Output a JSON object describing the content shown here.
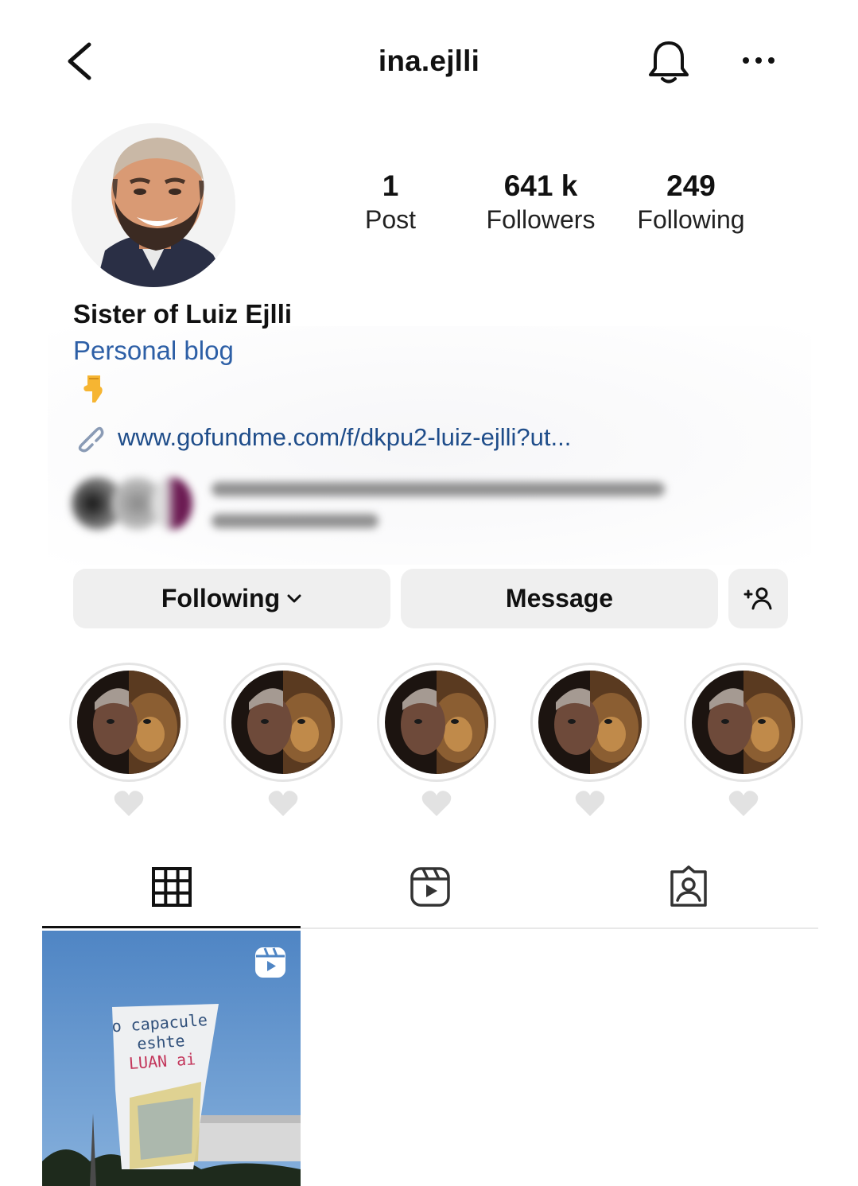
{
  "header": {
    "username": "ina.ejlli",
    "back_icon": "chevron-left-icon",
    "bell_icon": "bell-icon",
    "more_icon": "more-horizontal-icon"
  },
  "profile": {
    "stats": [
      {
        "value": "1",
        "label": "Post"
      },
      {
        "value": "641 k",
        "label": "Followers"
      },
      {
        "value": "249",
        "label": "Following"
      }
    ],
    "display_name": "Sister of Luiz Ejlli",
    "category": "Personal blog",
    "emoji": "👇",
    "link": "www.gofundme.com/f/dkpu2-luiz-ejlli?ut..."
  },
  "actions": {
    "following_label": "Following",
    "message_label": "Message",
    "add_icon": "add-person-icon"
  },
  "highlights": [
    {
      "label_icon": "white-heart-icon"
    },
    {
      "label_icon": "white-heart-icon"
    },
    {
      "label_icon": "white-heart-icon"
    },
    {
      "label_icon": "white-heart-icon"
    },
    {
      "label_icon": "white-heart-icon"
    }
  ],
  "tabs": [
    {
      "icon": "grid-icon",
      "active": true
    },
    {
      "icon": "reels-icon",
      "active": false
    },
    {
      "icon": "tagged-icon",
      "active": false
    }
  ],
  "posts": [
    {
      "type": "reel",
      "banner_text": [
        "o capacule",
        "eshte",
        "LUAN ai"
      ]
    }
  ],
  "colors": {
    "link": "#1f4d8a",
    "category": "#2d5fa6",
    "button_bg": "#efefef",
    "active_tab": "#111111"
  }
}
